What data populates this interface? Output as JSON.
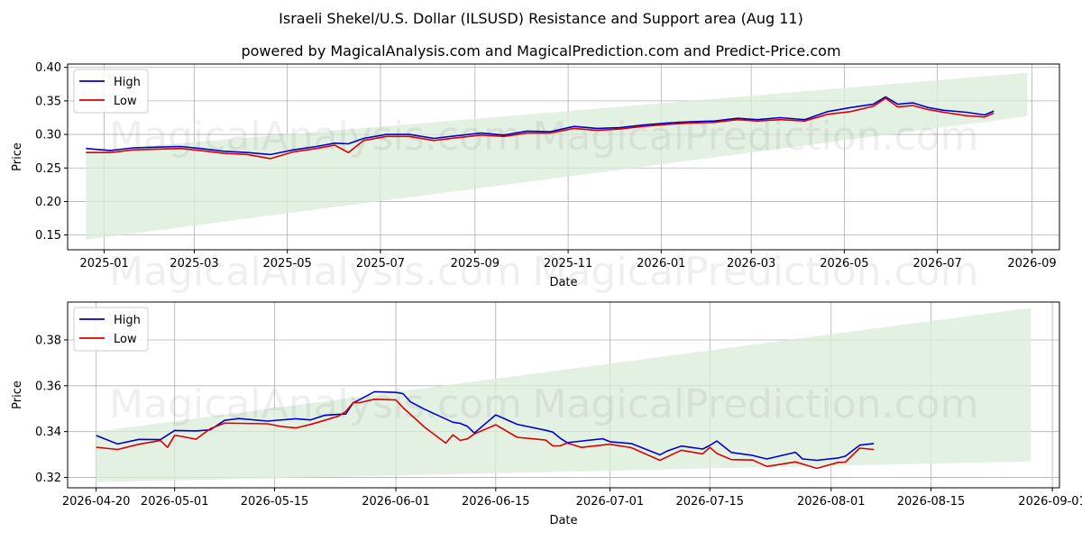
{
  "title": "Israeli Shekel/U.S. Dollar (ILSUSD) Resistance and Support area (Aug 11)",
  "subtitle": "powered by MagicalAnalysis.com and MagicalPrediction.com and Predict-Price.com",
  "watermarks": [
    "MagicalAnalysis.com",
    "MagicalPrediction.com"
  ],
  "colors": {
    "high": "#0000cc",
    "low": "#dd0000",
    "band": "#d9ecd9",
    "grid": "#b0b0b0"
  },
  "chart_data": [
    {
      "type": "line",
      "xlabel": "Date",
      "ylabel": "Price",
      "grid": true,
      "legend_position": "top-left",
      "xlim": [
        "2024-12-08",
        "2026-09-19"
      ],
      "ylim": [
        0.128,
        0.405
      ],
      "x_ticks": [
        "2025-01",
        "2025-03",
        "2025-05",
        "2025-07",
        "2025-09",
        "2025-11",
        "2026-01",
        "2026-03",
        "2026-05",
        "2026-07",
        "2026-09"
      ],
      "y_ticks": [
        0.15,
        0.2,
        0.25,
        0.3,
        0.35,
        0.4
      ],
      "y_tick_labels": [
        "0.15",
        "0.20",
        "0.25",
        "0.30",
        "0.35",
        "0.40"
      ],
      "band": {
        "x": [
          "2024-12-20",
          "2026-08-29"
        ],
        "upper": [
          0.275,
          0.392
        ],
        "lower": [
          0.143,
          0.327
        ]
      },
      "series": [
        {
          "name": "High",
          "x": [
            "2024-12-20",
            "2025-01-05",
            "2025-01-20",
            "2025-02-05",
            "2025-02-20",
            "2025-03-05",
            "2025-03-20",
            "2025-04-05",
            "2025-04-20",
            "2025-05-05",
            "2025-05-20",
            "2025-06-01",
            "2025-06-10",
            "2025-06-20",
            "2025-07-05",
            "2025-07-20",
            "2025-08-05",
            "2025-08-20",
            "2025-09-05",
            "2025-09-20",
            "2025-10-05",
            "2025-10-20",
            "2025-11-05",
            "2025-11-20",
            "2025-12-05",
            "2025-12-20",
            "2026-01-05",
            "2026-01-20",
            "2026-02-05",
            "2026-02-20",
            "2026-03-05",
            "2026-03-20",
            "2026-04-05",
            "2026-04-20",
            "2026-05-05",
            "2026-05-20",
            "2026-05-28",
            "2026-06-05",
            "2026-06-15",
            "2026-06-25",
            "2026-07-05",
            "2026-07-20",
            "2026-08-01",
            "2026-08-07"
          ],
          "values": [
            0.279,
            0.276,
            0.28,
            0.281,
            0.282,
            0.279,
            0.275,
            0.273,
            0.27,
            0.277,
            0.282,
            0.287,
            0.286,
            0.294,
            0.3,
            0.3,
            0.294,
            0.298,
            0.302,
            0.299,
            0.305,
            0.304,
            0.312,
            0.309,
            0.31,
            0.314,
            0.317,
            0.319,
            0.32,
            0.324,
            0.322,
            0.325,
            0.322,
            0.334,
            0.34,
            0.345,
            0.356,
            0.345,
            0.347,
            0.34,
            0.336,
            0.333,
            0.329,
            0.335
          ]
        },
        {
          "name": "Low",
          "x": [
            "2024-12-20",
            "2025-01-05",
            "2025-01-20",
            "2025-02-05",
            "2025-02-20",
            "2025-03-05",
            "2025-03-20",
            "2025-04-05",
            "2025-04-20",
            "2025-05-05",
            "2025-05-20",
            "2025-06-01",
            "2025-06-10",
            "2025-06-20",
            "2025-07-05",
            "2025-07-20",
            "2025-08-05",
            "2025-08-20",
            "2025-09-05",
            "2025-09-20",
            "2025-10-05",
            "2025-10-20",
            "2025-11-05",
            "2025-11-20",
            "2025-12-05",
            "2025-12-20",
            "2026-01-05",
            "2026-01-20",
            "2026-02-05",
            "2026-02-20",
            "2026-03-05",
            "2026-03-20",
            "2026-04-05",
            "2026-04-20",
            "2026-05-05",
            "2026-05-20",
            "2026-05-28",
            "2026-06-05",
            "2026-06-15",
            "2026-06-25",
            "2026-07-05",
            "2026-07-20",
            "2026-08-01",
            "2026-08-07"
          ],
          "values": [
            0.273,
            0.273,
            0.277,
            0.278,
            0.279,
            0.276,
            0.272,
            0.27,
            0.264,
            0.274,
            0.279,
            0.284,
            0.273,
            0.291,
            0.297,
            0.297,
            0.291,
            0.295,
            0.299,
            0.297,
            0.302,
            0.302,
            0.309,
            0.306,
            0.308,
            0.312,
            0.315,
            0.317,
            0.318,
            0.322,
            0.32,
            0.322,
            0.32,
            0.33,
            0.334,
            0.342,
            0.354,
            0.341,
            0.343,
            0.337,
            0.333,
            0.328,
            0.326,
            0.332
          ]
        }
      ]
    },
    {
      "type": "line",
      "xlabel": "Date",
      "ylabel": "Price",
      "grid": true,
      "legend_position": "top-left",
      "xlim": [
        "2026-04-16",
        "2026-09-02"
      ],
      "ylim": [
        0.3155,
        0.3965
      ],
      "x_ticks": [
        "2026-04-20",
        "2026-05-01",
        "2026-05-15",
        "2026-06-01",
        "2026-06-15",
        "2026-07-01",
        "2026-07-15",
        "2026-08-01",
        "2026-08-15",
        "2026-09-01"
      ],
      "y_ticks": [
        0.32,
        0.34,
        0.36,
        0.38
      ],
      "y_tick_labels": [
        "0.32",
        "0.34",
        "0.36",
        "0.38"
      ],
      "band": {
        "x": [
          "2026-04-20",
          "2026-08-29"
        ],
        "upper": [
          0.34,
          0.394
        ],
        "lower": [
          0.318,
          0.327
        ]
      },
      "series": [
        {
          "name": "High",
          "x": [
            "2026-04-20",
            "2026-04-23",
            "2026-04-26",
            "2026-04-29",
            "2026-05-01",
            "2026-05-04",
            "2026-05-06",
            "2026-05-08",
            "2026-05-10",
            "2026-05-14",
            "2026-05-18",
            "2026-05-20",
            "2026-05-22",
            "2026-05-24",
            "2026-05-25",
            "2026-05-26",
            "2026-05-27",
            "2026-05-29",
            "2026-06-01",
            "2026-06-02",
            "2026-06-03",
            "2026-06-05",
            "2026-06-08",
            "2026-06-09",
            "2026-06-10",
            "2026-06-11",
            "2026-06-12",
            "2026-06-15",
            "2026-06-18",
            "2026-06-22",
            "2026-06-23",
            "2026-06-24",
            "2026-06-25",
            "2026-06-30",
            "2026-07-01",
            "2026-07-04",
            "2026-07-08",
            "2026-07-09",
            "2026-07-11",
            "2026-07-14",
            "2026-07-15",
            "2026-07-16",
            "2026-07-18",
            "2026-07-21",
            "2026-07-23",
            "2026-07-27",
            "2026-07-28",
            "2026-07-30",
            "2026-08-02",
            "2026-08-03",
            "2026-08-05",
            "2026-08-07"
          ],
          "values": [
            0.3383,
            0.3346,
            0.3366,
            0.3365,
            0.3405,
            0.3403,
            0.3408,
            0.3449,
            0.3457,
            0.3446,
            0.3456,
            0.3451,
            0.3471,
            0.3475,
            0.3477,
            0.3525,
            0.3541,
            0.3574,
            0.3571,
            0.3566,
            0.3531,
            0.3498,
            0.3455,
            0.3441,
            0.3436,
            0.3423,
            0.3394,
            0.3473,
            0.3432,
            0.3406,
            0.3398,
            0.3372,
            0.3352,
            0.3369,
            0.3356,
            0.3348,
            0.3299,
            0.3315,
            0.3337,
            0.3324,
            0.334,
            0.3359,
            0.3309,
            0.3296,
            0.3281,
            0.331,
            0.3281,
            0.3275,
            0.3285,
            0.3293,
            0.3341,
            0.3348
          ]
        },
        {
          "name": "Low",
          "x": [
            "2026-04-20",
            "2026-04-23",
            "2026-04-26",
            "2026-04-29",
            "2026-04-30",
            "2026-05-01",
            "2026-05-02",
            "2026-05-04",
            "2026-05-06",
            "2026-05-08",
            "2026-05-10",
            "2026-05-14",
            "2026-05-16",
            "2026-05-18",
            "2026-05-20",
            "2026-05-22",
            "2026-05-24",
            "2026-05-25",
            "2026-05-26",
            "2026-05-27",
            "2026-05-29",
            "2026-06-01",
            "2026-06-02",
            "2026-06-05",
            "2026-06-08",
            "2026-06-09",
            "2026-06-10",
            "2026-06-11",
            "2026-06-12",
            "2026-06-15",
            "2026-06-18",
            "2026-06-22",
            "2026-06-23",
            "2026-06-24",
            "2026-06-25",
            "2026-06-27",
            "2026-07-01",
            "2026-07-04",
            "2026-07-08",
            "2026-07-11",
            "2026-07-14",
            "2026-07-15",
            "2026-07-16",
            "2026-07-18",
            "2026-07-21",
            "2026-07-23",
            "2026-07-27",
            "2026-07-30",
            "2026-08-02",
            "2026-08-03",
            "2026-08-05",
            "2026-08-07"
          ],
          "values": [
            0.3332,
            0.3322,
            0.3345,
            0.3361,
            0.3331,
            0.3384,
            0.3379,
            0.3367,
            0.3413,
            0.3437,
            0.3436,
            0.3434,
            0.3422,
            0.3416,
            0.3431,
            0.3449,
            0.3468,
            0.3488,
            0.3526,
            0.3527,
            0.3541,
            0.3538,
            0.3505,
            0.342,
            0.335,
            0.3386,
            0.3362,
            0.3368,
            0.339,
            0.343,
            0.3375,
            0.3363,
            0.3338,
            0.3338,
            0.335,
            0.3331,
            0.3345,
            0.333,
            0.3275,
            0.3319,
            0.3303,
            0.3331,
            0.3305,
            0.3278,
            0.3276,
            0.3248,
            0.3268,
            0.324,
            0.3266,
            0.3267,
            0.3328,
            0.3322
          ]
        }
      ]
    }
  ]
}
